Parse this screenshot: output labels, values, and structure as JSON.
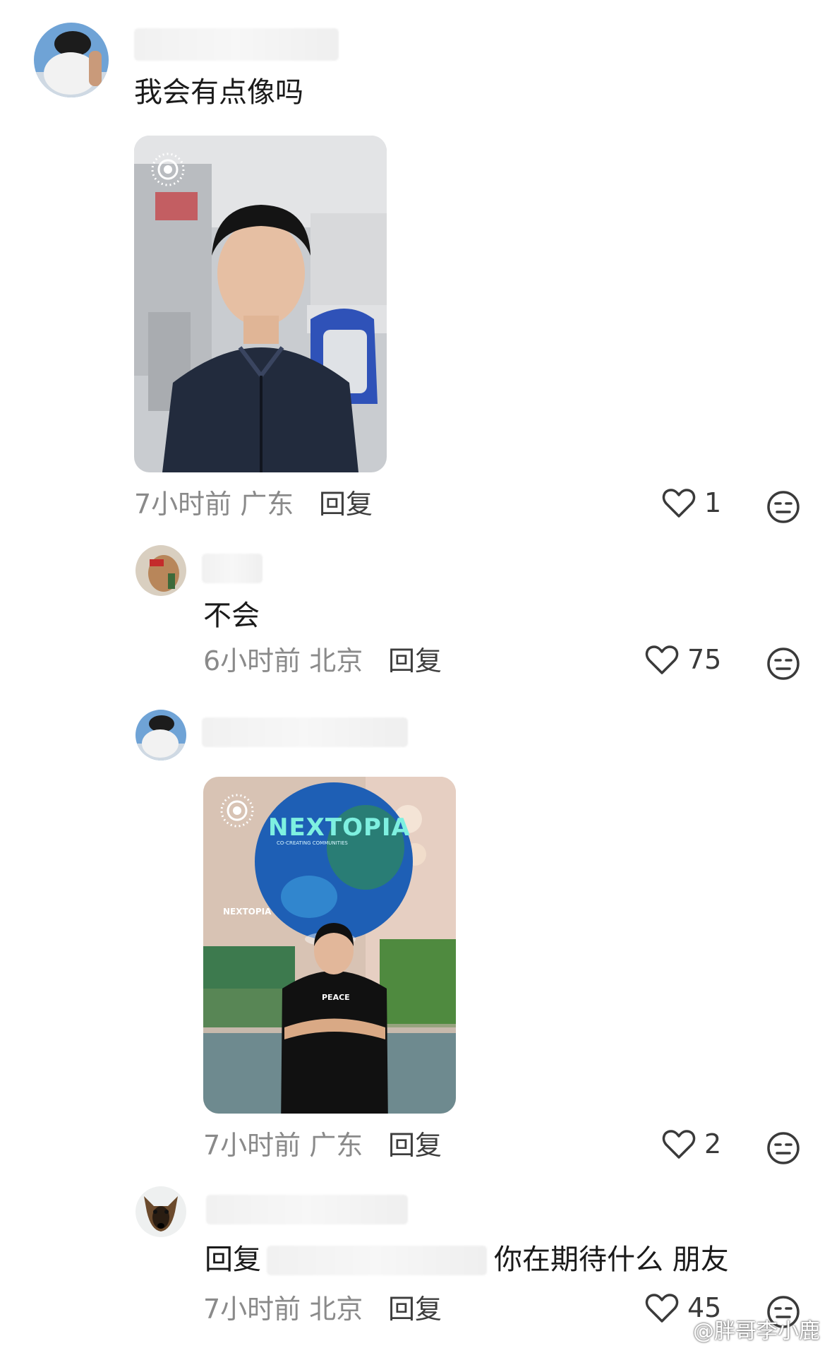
{
  "comments": [
    {
      "text": "我会有点像吗",
      "time": "7小时前",
      "location": "广东",
      "reply_label": "回复",
      "likes": "1"
    },
    {
      "text": "不会",
      "time": "6小时前",
      "location": "北京",
      "reply_label": "回复",
      "likes": "75"
    },
    {
      "time": "7小时前",
      "location": "广东",
      "reply_label": "回复",
      "likes": "2"
    },
    {
      "reply_prefix": "回复",
      "text": "你在期待什么 朋友",
      "time": "7小时前",
      "location": "北京",
      "reply_label": "回复",
      "likes": "45"
    }
  ],
  "photo2": {
    "globe_text": "NEXTOPIA",
    "globe_sub": "CO-CREATING COMMUNITIES",
    "sign_text": "NEXTOPIA",
    "shirt_text": "PEACE"
  },
  "watermark": "@胖哥李小鹿",
  "icons": [
    "live-photo-icon",
    "heart-icon",
    "dislike-face-icon",
    "weibo-icon"
  ]
}
